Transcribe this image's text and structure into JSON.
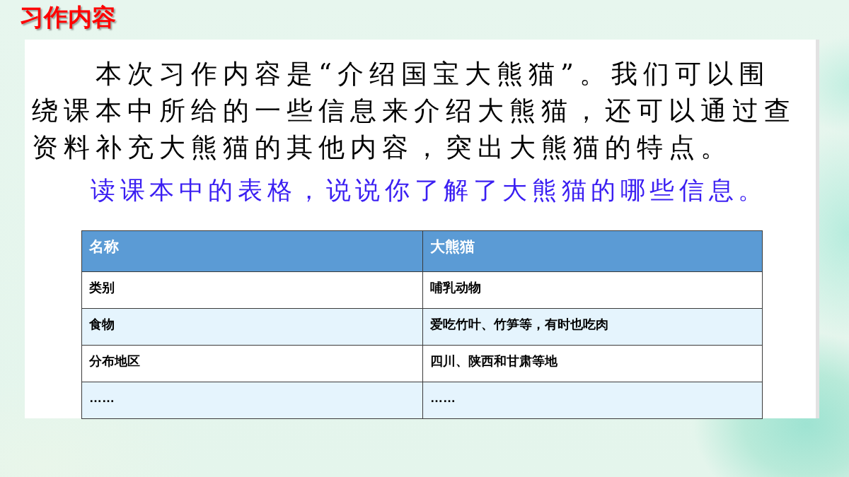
{
  "title": "习作内容",
  "intro": {
    "paragraph": "本次习作内容是“介绍国宝大熊猫”。我们可以围绕课本中所给的一些信息来介绍大熊猫，还可以通过查资料补充大熊猫的其他内容，突出大熊猫的特点。",
    "prompt": "读课本中的表格，说说你了解了大熊猫的哪些信息。"
  },
  "table": {
    "columns": [
      "名称",
      "大熊猫"
    ],
    "rows": [
      [
        "类别",
        "哺乳动物"
      ],
      [
        "食物",
        "爱吃竹叶、竹笋等，有时也吃肉"
      ],
      [
        "分布地区",
        "四川、陕西和甘肃等地"
      ],
      [
        "……",
        "……"
      ]
    ]
  }
}
